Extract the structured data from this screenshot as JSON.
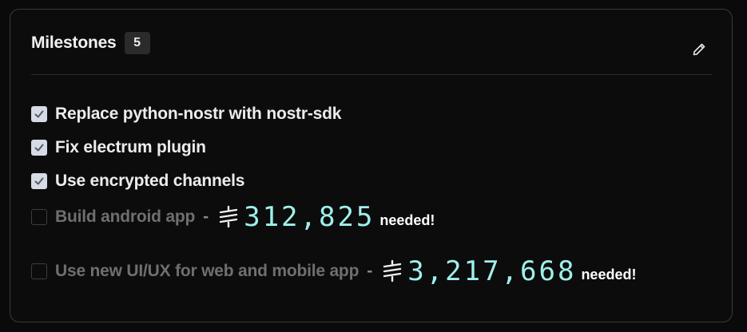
{
  "milestones": {
    "title": "Milestones",
    "count": "5",
    "edit_icon": "pencil-icon",
    "items": [
      {
        "label": "Replace python-nostr with nostr-sdk",
        "checked": true
      },
      {
        "label": "Fix electrum plugin",
        "checked": true
      },
      {
        "label": "Use encrypted channels",
        "checked": true
      },
      {
        "label": "Build android app",
        "checked": false,
        "separator": "-",
        "amount": "312,825",
        "suffix": "needed!"
      },
      {
        "label": "Use new UI/UX for web and mobile app",
        "checked": false,
        "separator": "-",
        "amount": "3,217,668",
        "suffix": "needed!"
      }
    ]
  },
  "colors": {
    "accent_amount": "#9ff0ea",
    "checkbox_checked": "#d7dbe6",
    "text_done": "#ececec",
    "text_pending": "#6f6f6f"
  }
}
